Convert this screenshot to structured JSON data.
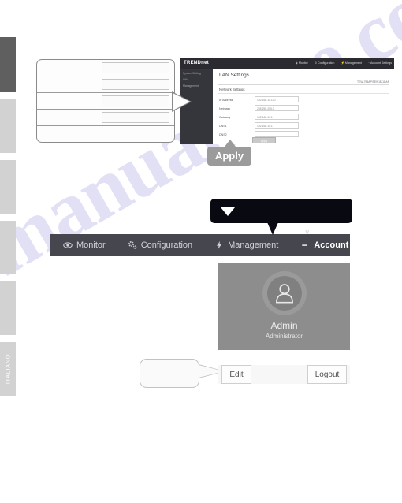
{
  "watermark": {
    "text": "manualslive.com"
  },
  "language_tabs": [
    {
      "label": "",
      "active": true
    },
    {
      "label": "",
      "active": false
    },
    {
      "label": "",
      "active": false
    },
    {
      "label": "",
      "active": false
    },
    {
      "label": "",
      "active": false
    },
    {
      "label": "ITALIANO",
      "active": false
    }
  ],
  "callout_form": {
    "rows": [
      {
        "label": "",
        "value": ""
      },
      {
        "label": "",
        "value": ""
      },
      {
        "label": "",
        "value": ""
      },
      {
        "label": "",
        "value": ""
      },
      {
        "label": "",
        "value": ""
      }
    ]
  },
  "router_ui": {
    "brand": "TRENDnet",
    "top_nav": [
      {
        "label": "Monitor"
      },
      {
        "label": "Configuration"
      },
      {
        "label": "Management"
      },
      {
        "label": "Account Settings"
      }
    ],
    "sidebar": [
      {
        "label": "System Setting"
      },
      {
        "label": "LAN"
      },
      {
        "label": "Management"
      }
    ],
    "page_title": "LAN Settings",
    "model_tag": "TEW-755AP/TEW-821DAP",
    "section_title": "Network Settings",
    "fields": [
      {
        "label": "IP Address",
        "value": "192.168.10.100"
      },
      {
        "label": "Netmask",
        "value": "255.255.255.0"
      },
      {
        "label": "Gateway",
        "value": "192.168.10.1"
      },
      {
        "label": "DNS1",
        "value": "192.168.10.1"
      },
      {
        "label": "DNS2",
        "value": ""
      }
    ],
    "apply_label": "Apply"
  },
  "apply_callout": {
    "label": "Apply"
  },
  "black_callout": {
    "label": "",
    "arrow": "triangle-down-icon"
  },
  "main_nav": {
    "items": [
      {
        "label": "Monitor",
        "icon": "eye-icon",
        "active": false
      },
      {
        "label": "Configuration",
        "icon": "gears-icon",
        "active": false
      },
      {
        "label": "Management",
        "icon": "bolt-icon",
        "active": false
      },
      {
        "label": "Account Settings",
        "icon": "dash-icon",
        "active": true
      }
    ],
    "tick": "v"
  },
  "admin_card": {
    "avatar_icon": "user-avatar-icon",
    "name": "Admin",
    "role": "Administrator"
  },
  "bottom_bar": {
    "edit_label": "Edit",
    "logout_label": "Logout"
  },
  "colors": {
    "nav_bar": "#46464e",
    "admin_card": "#8d8d8d",
    "black_callout": "#090911",
    "apply_callout": "#9b9b9b",
    "watermark": "#c9c8ee",
    "lang_tab_active": "#5f5f5f",
    "lang_tab": "#d2d2d2"
  }
}
